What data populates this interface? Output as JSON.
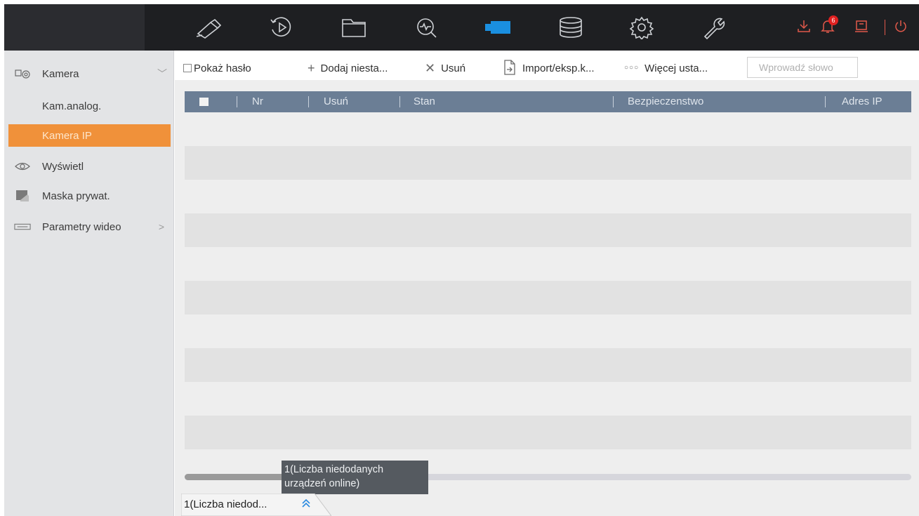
{
  "topbar": {
    "nav_icons": [
      "camera-icon",
      "playback-icon",
      "folder-icon",
      "search-icon",
      "video-camera-icon",
      "storage-icon",
      "settings-icon",
      "maintenance-icon"
    ],
    "active_icon": "video-camera-icon",
    "right_icons": [
      "download-icon",
      "notification-icon",
      "display-icon",
      "power-icon"
    ],
    "notification_count": "6",
    "accent_color": "#1a8fe0"
  },
  "sidebar": {
    "items": [
      {
        "label": "Kamera",
        "icon": "camera-group-icon",
        "chevron": "down"
      },
      {
        "label": "Kam.analog.",
        "icon": "",
        "sub": true
      },
      {
        "label": "Kamera IP",
        "icon": "",
        "sub": true,
        "active": true
      },
      {
        "label": "Wyświetl",
        "icon": "eye-icon"
      },
      {
        "label": "Maska prywat.",
        "icon": "privacy-mask-icon"
      },
      {
        "label": "Parametry wideo",
        "icon": "video-params-icon",
        "chevron": "right"
      }
    ],
    "active_color": "#f0913a"
  },
  "toolbar": {
    "show_password_label": "Pokaż hasło",
    "add_label": "Dodaj niesta...",
    "delete_label": "Usuń",
    "import_label": "Import/eksp.k...",
    "more_label": "Więcej usta...",
    "search_placeholder": "Wprowadź słowo"
  },
  "table": {
    "columns": [
      "Nr",
      "Usuń",
      "Stan",
      "Bezpieczenstwo",
      "Adres IP"
    ],
    "header_color": "#6b7e95",
    "rows": []
  },
  "tooltip": {
    "line1": "1(Liczba niedodanych",
    "line2": "urządzeń online)"
  },
  "bottom_tab": {
    "label": "1(Liczba niedod..."
  }
}
